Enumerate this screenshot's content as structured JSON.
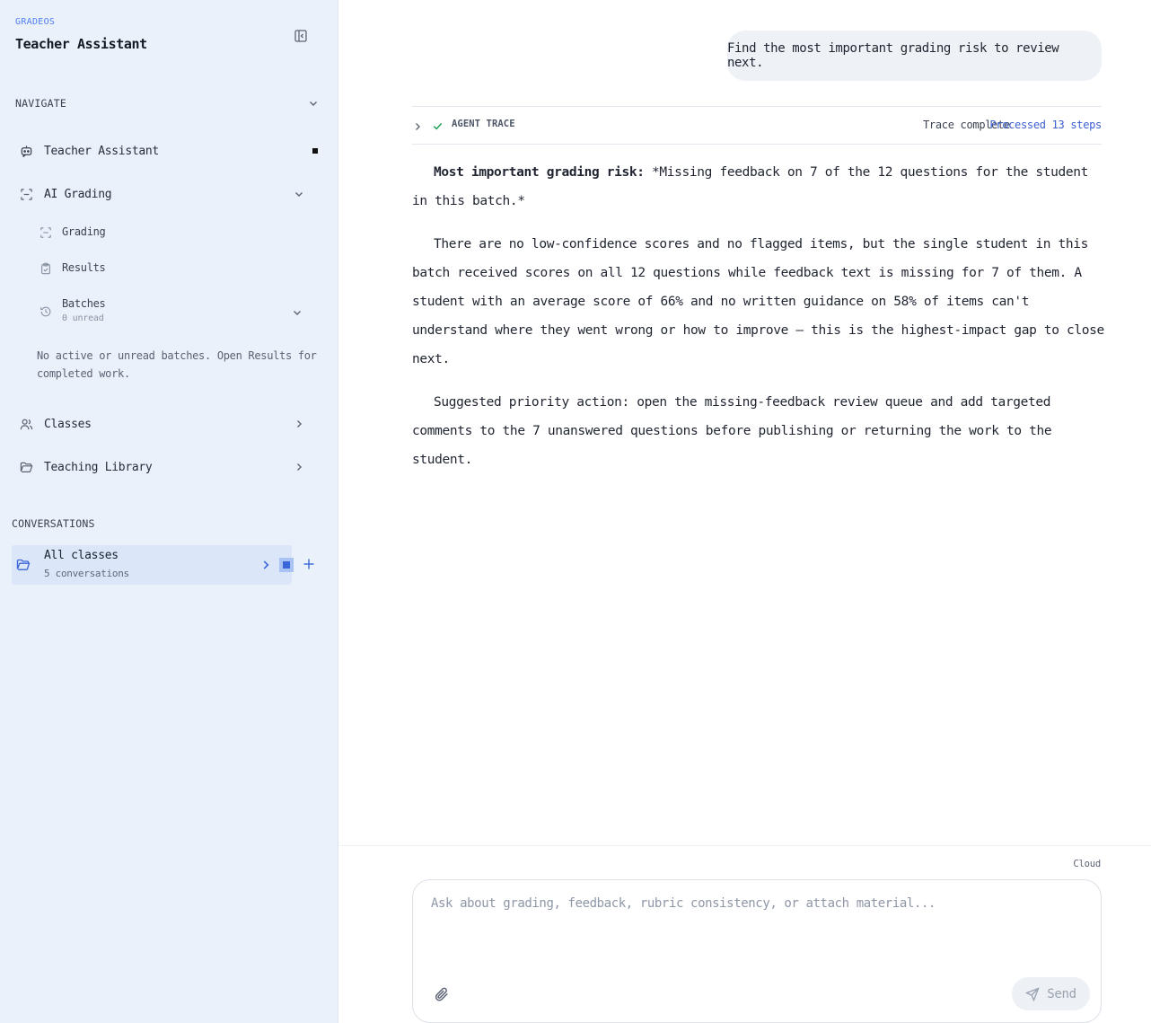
{
  "sidebar": {
    "brand_small": "GRADEOS",
    "brand_title": "Teacher Assistant",
    "navigate_label": "NAVIGATE",
    "nav": {
      "teacher_assistant": "Teacher Assistant",
      "ai_grading": "AI Grading",
      "grading": "Grading",
      "results": "Results",
      "batches": "Batches",
      "batches_unread": "0 unread",
      "info": "No active or unread batches. Open Results for completed work.",
      "classes": "Classes",
      "teaching_library": "Teaching Library"
    },
    "conversations_label": "CONVERSATIONS",
    "conversation": {
      "title": "All classes",
      "subtitle": "5 conversations"
    }
  },
  "chat": {
    "user_message": "Find the most important grading risk to review next.",
    "trace": {
      "label": "AGENT TRACE",
      "status": "Trace complete",
      "steps": "Processed 13 steps"
    },
    "answer": {
      "p1_bold": "Most important grading risk:",
      "p1_rest": " *Missing feedback on 7 of the 12 questions for the student in this batch.*",
      "p2": "There are no low-confidence scores and no flagged items, but the single student in this batch received scores on all 12 questions while feedback text is missing for 7 of them. A student with an average score of 66% and no written guidance on 58% of items can't understand where they went wrong or how to improve — this is the highest-impact gap to close next.",
      "p3": "Suggested priority action: open the missing-feedback review queue and add targeted comments to the 7 unanswered questions before publishing or returning the work to the student."
    }
  },
  "composer": {
    "mode": "Cloud",
    "placeholder": "Ask about grading, feedback, rubric consistency, or attach material...",
    "value": "",
    "send_label": "Send"
  },
  "colors": {
    "sidebar_bg": "#eaf1fb",
    "accent": "#3b5fd0",
    "selected_bg": "#dbe6f8"
  }
}
